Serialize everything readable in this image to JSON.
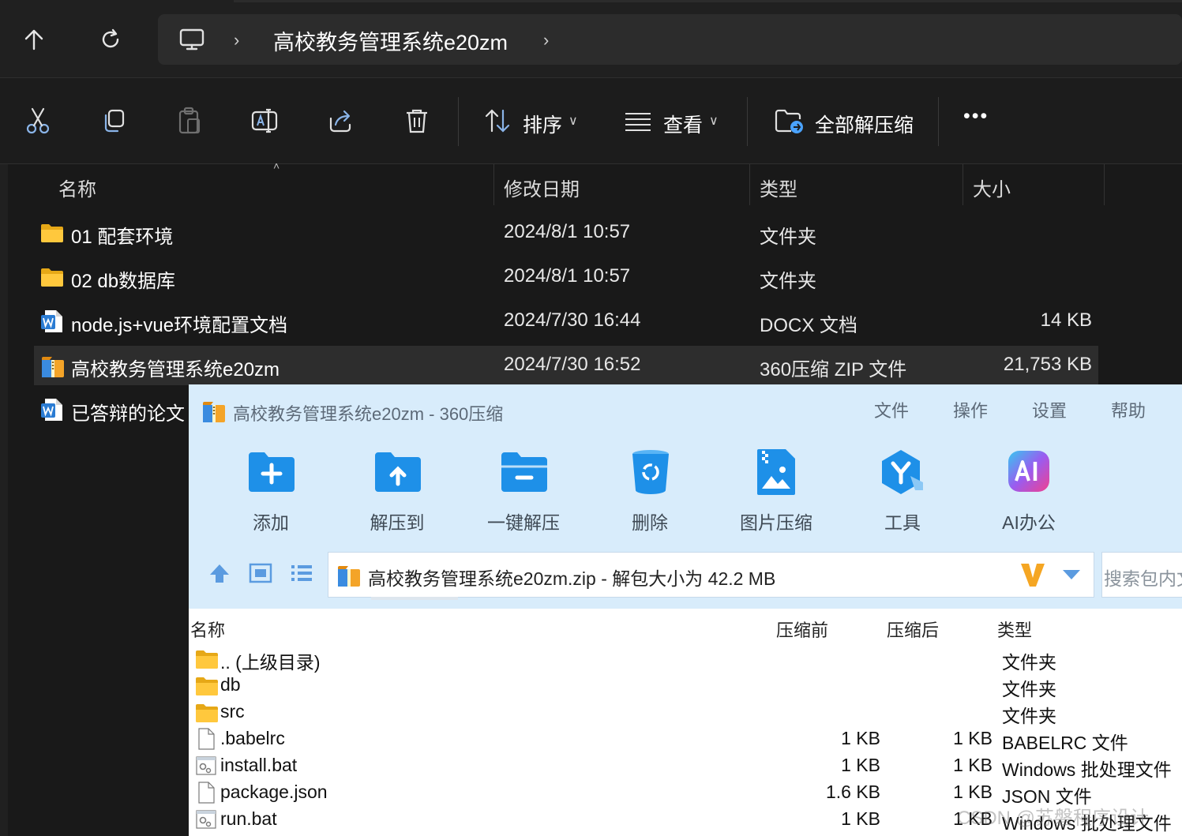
{
  "explorer": {
    "breadcrumb": {
      "current": "高校教务管理系统e20zm"
    },
    "toolbar": {
      "sort_label": "排序",
      "view_label": "查看",
      "extract_all_label": "全部解压缩",
      "more_label": "•••"
    },
    "columns": {
      "name": "名称",
      "modified": "修改日期",
      "type": "类型",
      "size": "大小"
    },
    "files": [
      {
        "icon": "folder-icon",
        "name": "01 配套环境",
        "modified": "2024/8/1 10:57",
        "type": "文件夹",
        "size": ""
      },
      {
        "icon": "folder-icon",
        "name": "02 db数据库",
        "modified": "2024/8/1 10:57",
        "type": "文件夹",
        "size": ""
      },
      {
        "icon": "word-doc-icon",
        "name": "node.js+vue环境配置文档",
        "modified": "2024/7/30 16:44",
        "type": "DOCX 文档",
        "size": "14 KB"
      },
      {
        "icon": "zip-archive-icon",
        "name": "高校教务管理系统e20zm",
        "modified": "2024/7/30 16:52",
        "type": "360压缩 ZIP 文件",
        "size": "21,753 KB",
        "selected": true
      },
      {
        "icon": "word-doc-icon",
        "name": "已答辩的论文",
        "modified": "",
        "type": "",
        "size": ""
      }
    ]
  },
  "zip": {
    "title": "高校教务管理系统e20zm - 360压缩",
    "menu": [
      "文件",
      "操作",
      "设置",
      "帮助"
    ],
    "actions": [
      {
        "icon": "add-folder-icon",
        "label": "添加",
        "color": "#1e90e8"
      },
      {
        "icon": "extract-to-icon",
        "label": "解压到",
        "color": "#1e90e8"
      },
      {
        "icon": "one-click-extract-icon",
        "label": "一键解压",
        "color": "#1e90e8"
      },
      {
        "icon": "recycle-delete-icon",
        "label": "删除",
        "color": "#1e90e8"
      },
      {
        "icon": "image-compress-icon",
        "label": "图片压缩",
        "color": "#1e90e8"
      },
      {
        "icon": "tools-icon",
        "label": "工具",
        "color": "#1e90e8"
      },
      {
        "icon": "ai-office-icon",
        "label": "AI办公",
        "color": "#e040a0"
      }
    ],
    "path_text": "高校教务管理系统e20zm.zip - 解包大小为 42.2 MB",
    "search_placeholder": "搜索包内文",
    "columns": {
      "name": "名称",
      "before": "压缩前",
      "after": "压缩后",
      "type": "类型"
    },
    "entries": [
      {
        "icon": "folder-icon",
        "name": ".. (上级目录)",
        "before": "",
        "after": "",
        "type": "文件夹"
      },
      {
        "icon": "folder-icon",
        "name": "db",
        "before": "",
        "after": "",
        "type": "文件夹"
      },
      {
        "icon": "folder-icon",
        "name": "src",
        "before": "",
        "after": "",
        "type": "文件夹"
      },
      {
        "icon": "blank-file-icon",
        "name": ".babelrc",
        "before": "1 KB",
        "after": "1 KB",
        "type": "BABELRC 文件"
      },
      {
        "icon": "batch-file-icon",
        "name": "install.bat",
        "before": "1 KB",
        "after": "1 KB",
        "type": "Windows 批处理文件"
      },
      {
        "icon": "blank-file-icon",
        "name": "package.json",
        "before": "1.6 KB",
        "after": "1 KB",
        "type": "JSON 文件"
      },
      {
        "icon": "batch-file-icon",
        "name": "run.bat",
        "before": "1 KB",
        "after": "1 KB",
        "type": "Windows 批处理文件"
      }
    ]
  },
  "watermark": "CSDN @苏磐程序设计"
}
